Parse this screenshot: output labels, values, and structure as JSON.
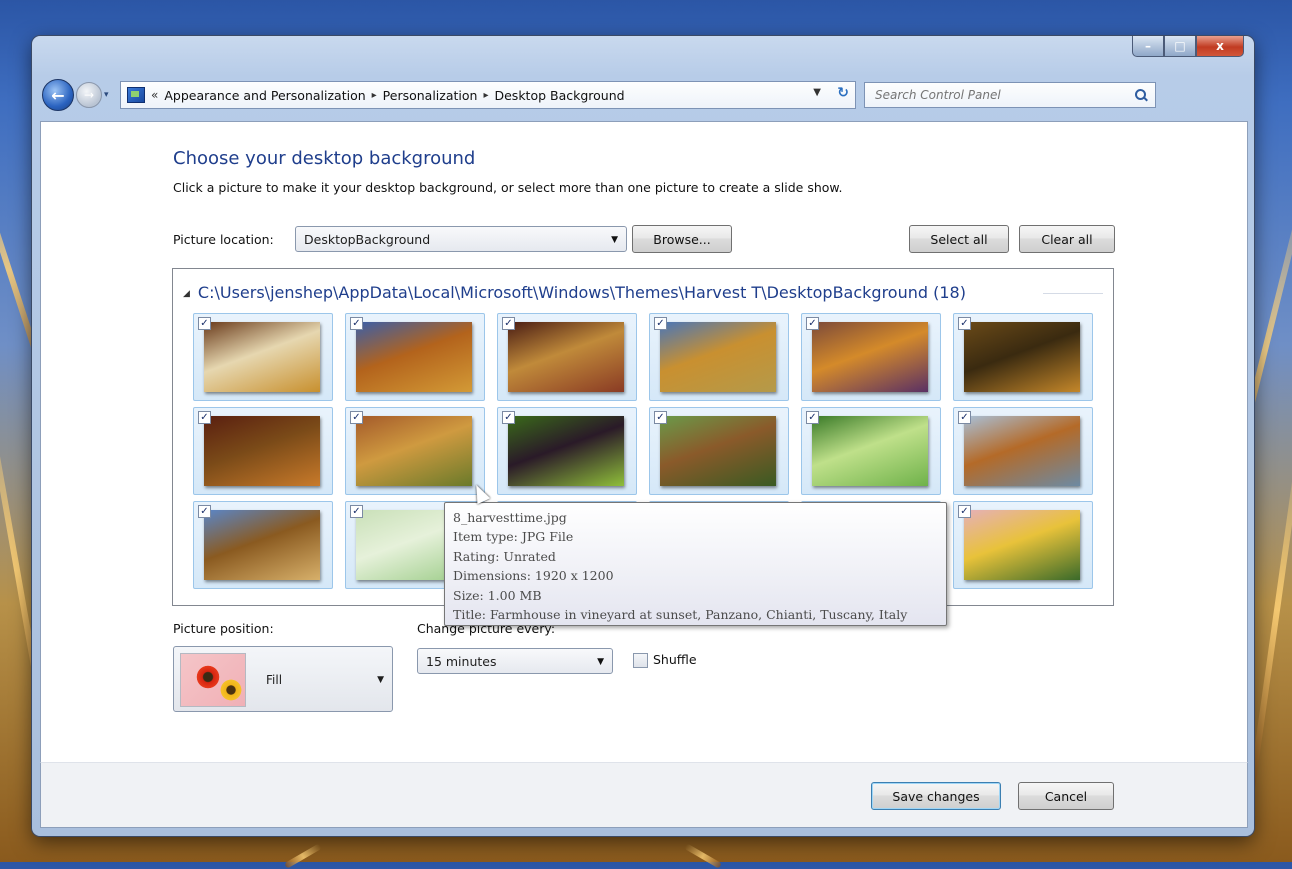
{
  "window": {
    "caption": {
      "minimize": "–",
      "maximize": "□",
      "close": "x"
    }
  },
  "nav": {
    "recent_arrow": "▾",
    "crumbs": [
      "Appearance and Personalization",
      "Personalization",
      "Desktop Background"
    ],
    "crumb_sep": "▸",
    "overflow": "«",
    "search_placeholder": "Search Control Panel"
  },
  "page": {
    "title": "Choose your desktop background",
    "subtitle": "Click a picture to make it your desktop background, or select more than one picture to create a slide show.",
    "picture_location_label": "Picture location:",
    "picture_location_value": "DesktopBackground",
    "browse_label": "Browse...",
    "select_all_label": "Select all",
    "clear_all_label": "Clear all",
    "group_title": "C:\\Users\\jenshep\\AppData\\Local\\Microsoft\\Windows\\Themes\\Harvest T\\DesktopBackground (18)"
  },
  "thumbnails": [
    {
      "checked": true,
      "colors": [
        "#6a3b1c",
        "#c8902e",
        "#e6d7b0"
      ]
    },
    {
      "checked": true,
      "colors": [
        "#3b5fa8",
        "#d39a36",
        "#b3631c"
      ]
    },
    {
      "checked": true,
      "colors": [
        "#4a1d14",
        "#8a3b24",
        "#c08a3a"
      ]
    },
    {
      "checked": true,
      "colors": [
        "#4a76b8",
        "#b49a4a",
        "#c99030"
      ]
    },
    {
      "checked": true,
      "colors": [
        "#7c4a3a",
        "#5a3064",
        "#d48a2a"
      ]
    },
    {
      "checked": true,
      "colors": [
        "#6a4a18",
        "#c4872a",
        "#3a2a10"
      ]
    },
    {
      "checked": true,
      "colors": [
        "#5a1f10",
        "#c87a2a",
        "#7a4a18"
      ]
    },
    {
      "checked": true,
      "colors": [
        "#a45a2a",
        "#6a7a2a",
        "#cf9a40"
      ]
    },
    {
      "checked": true,
      "colors": [
        "#3a6a1a",
        "#8fbf3a",
        "#2a1a28"
      ]
    },
    {
      "checked": true,
      "colors": [
        "#6a9a4a",
        "#3a5a22",
        "#8a5a2a"
      ]
    },
    {
      "checked": true,
      "colors": [
        "#3a7a28",
        "#6fb24a",
        "#bfe08a"
      ]
    },
    {
      "checked": true,
      "colors": [
        "#a9c0d8",
        "#6d8aa3",
        "#b46a28"
      ]
    },
    {
      "checked": true,
      "colors": [
        "#5a86c8",
        "#d7b06a",
        "#8a5a20"
      ]
    },
    {
      "checked": true,
      "colors": [
        "#c9e0b8",
        "#9ccc88",
        "#e6f1da"
      ]
    },
    {
      "checked": true,
      "colors": [
        "#c0cc9a",
        "#8fa860",
        "#dfe6c6"
      ]
    },
    {
      "checked": true,
      "colors": [
        "#8a7a4a",
        "#5a4a2a",
        "#cfb680"
      ]
    },
    {
      "checked": true,
      "colors": [
        "#7a6a3a",
        "#4a3a1a",
        "#b09a60"
      ]
    },
    {
      "checked": true,
      "colors": [
        "#e6b0b8",
        "#3a6a2a",
        "#e8c23a"
      ]
    }
  ],
  "tooltip": {
    "lines": [
      "8_harvesttime.jpg",
      "Item type: JPG File",
      "Rating: Unrated",
      "Dimensions: 1920 x 1200",
      "Size: 1.00 MB",
      "Title: Farmhouse in  vineyard at sunset, Panzano, Chianti, Tuscany, Italy"
    ]
  },
  "position": {
    "label": "Picture position:",
    "value": "Fill"
  },
  "interval": {
    "label": "Change picture every:",
    "value": "15 minutes",
    "shuffle_label": "Shuffle",
    "shuffle_checked": false
  },
  "footer": {
    "save_label": "Save changes",
    "cancel_label": "Cancel"
  }
}
